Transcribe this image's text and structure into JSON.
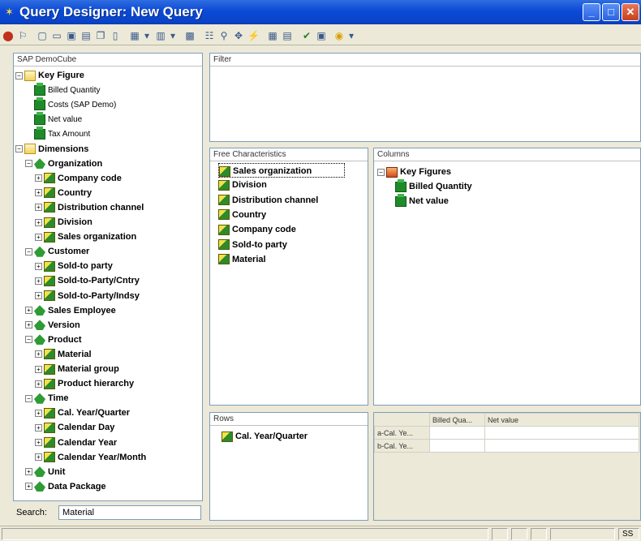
{
  "window": {
    "title": "Query Designer: New Query"
  },
  "toolbar": {
    "icons": [
      "exit-icon",
      "query-icon",
      "new-icon",
      "open-icon",
      "save-icon",
      "save-as-icon",
      "copy-icon",
      "cut-icon",
      "table-icon",
      "dropdown-arrow-icon",
      "layout-icon",
      "dropdown-arrow-icon",
      "grid-icon",
      "properties-icon",
      "tree-icon",
      "conditions-icon",
      "exceptions-icon",
      "cells-icon",
      "tabular-icon",
      "check-icon",
      "display-icon",
      "help-icon",
      "dropdown-arrow-icon"
    ]
  },
  "tree": {
    "header": "SAP DemoCube",
    "items": [
      {
        "label": "Key Figure",
        "level": 0,
        "icon": "folder",
        "expander": "−"
      },
      {
        "label": "Billed Quantity",
        "level": 1,
        "icon": "kf",
        "expander": ""
      },
      {
        "label": "Costs (SAP Demo)",
        "level": 1,
        "icon": "kf",
        "expander": ""
      },
      {
        "label": "Net value",
        "level": 1,
        "icon": "kf",
        "expander": ""
      },
      {
        "label": "Tax Amount",
        "level": 1,
        "icon": "kf",
        "expander": ""
      },
      {
        "label": "Dimensions",
        "level": 0,
        "icon": "folder",
        "expander": "−"
      },
      {
        "label": "Organization",
        "level": 1,
        "icon": "dim",
        "expander": "−"
      },
      {
        "label": "Company code",
        "level": 2,
        "icon": "char",
        "expander": "+"
      },
      {
        "label": "Country",
        "level": 2,
        "icon": "char",
        "expander": "+"
      },
      {
        "label": "Distribution channel",
        "level": 2,
        "icon": "char",
        "expander": "+"
      },
      {
        "label": "Division",
        "level": 2,
        "icon": "char",
        "expander": "+"
      },
      {
        "label": "Sales organization",
        "level": 2,
        "icon": "char",
        "expander": "+"
      },
      {
        "label": "Customer",
        "level": 1,
        "icon": "dim",
        "expander": "−"
      },
      {
        "label": "Sold-to party",
        "level": 2,
        "icon": "char",
        "expander": "+"
      },
      {
        "label": "Sold-to-Party/Cntry",
        "level": 2,
        "icon": "char",
        "expander": "+"
      },
      {
        "label": "Sold-to-Party/Indsy",
        "level": 2,
        "icon": "char",
        "expander": "+"
      },
      {
        "label": "Sales Employee",
        "level": 1,
        "icon": "dim",
        "expander": "+"
      },
      {
        "label": "Version",
        "level": 1,
        "icon": "dim",
        "expander": "+"
      },
      {
        "label": "Product",
        "level": 1,
        "icon": "dim",
        "expander": "−"
      },
      {
        "label": "Material",
        "level": 2,
        "icon": "char",
        "expander": "+"
      },
      {
        "label": "Material group",
        "level": 2,
        "icon": "char",
        "expander": "+"
      },
      {
        "label": "Product hierarchy",
        "level": 2,
        "icon": "char",
        "expander": "+"
      },
      {
        "label": "Time",
        "level": 1,
        "icon": "dim",
        "expander": "−"
      },
      {
        "label": "Cal. Year/Quarter",
        "level": 2,
        "icon": "char",
        "expander": "+"
      },
      {
        "label": "Calendar Day",
        "level": 2,
        "icon": "char",
        "expander": "+"
      },
      {
        "label": "Calendar Year",
        "level": 2,
        "icon": "char",
        "expander": "+"
      },
      {
        "label": "Calendar Year/Month",
        "level": 2,
        "icon": "char",
        "expander": "+"
      },
      {
        "label": "Unit",
        "level": 1,
        "icon": "dim",
        "expander": "+"
      },
      {
        "label": "Data Package",
        "level": 1,
        "icon": "dim",
        "expander": "+"
      }
    ]
  },
  "search": {
    "label": "Search:",
    "value": "Material"
  },
  "filter": {
    "header": "Filter"
  },
  "free_characteristics": {
    "header": "Free Characteristics",
    "items": [
      "Sales organization",
      "Division",
      "Distribution channel",
      "Country",
      "Company code",
      "Sold-to party",
      "Material"
    ]
  },
  "columns": {
    "header": "Columns",
    "group": "Key Figures",
    "items": [
      "Billed Quantity",
      "Net value"
    ]
  },
  "rows": {
    "header": "Rows",
    "items": [
      "Cal. Year/Quarter"
    ]
  },
  "preview": {
    "col_headers": [
      "Billed Qua...",
      "Net value"
    ],
    "row_headers": [
      "a-Cal. Ye...",
      "b-Cal. Ye..."
    ]
  },
  "statusbar": {
    "right_text": "SS"
  }
}
